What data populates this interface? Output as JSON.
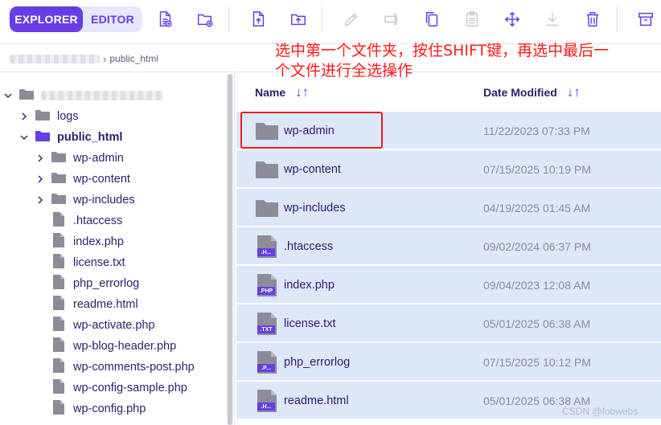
{
  "toolbar": {
    "tabs": [
      {
        "label": "EXPLORER",
        "active": true
      },
      {
        "label": "EDITOR",
        "active": false
      }
    ],
    "icons": [
      "new-file-icon",
      "new-folder-icon",
      "upload-file-icon",
      "upload-folder-icon",
      "rename-icon",
      "edit-icon",
      "copy-icon",
      "paste-icon",
      "move-icon",
      "download-icon",
      "delete-icon",
      "archive-icon"
    ],
    "accent": "#673de6"
  },
  "breadcrumb": {
    "current": "public_html"
  },
  "annotation": {
    "text": "选中第一个文件夹，按住SHIFT键，再选中最后一个文件进行全选操作",
    "color": "#ff1a1a"
  },
  "tree": {
    "items": [
      {
        "label": "logs",
        "type": "folder",
        "expandable": true,
        "expanded": false
      },
      {
        "label": "public_html",
        "type": "folder",
        "expandable": true,
        "expanded": true,
        "active": true
      },
      {
        "label": "wp-admin",
        "type": "folder",
        "expandable": true,
        "expanded": false
      },
      {
        "label": "wp-content",
        "type": "folder",
        "expandable": true,
        "expanded": false
      },
      {
        "label": "wp-includes",
        "type": "folder",
        "expandable": true,
        "expanded": false
      },
      {
        "label": ".htaccess",
        "type": "file"
      },
      {
        "label": "index.php",
        "type": "file"
      },
      {
        "label": "license.txt",
        "type": "file"
      },
      {
        "label": "php_errorlog",
        "type": "file"
      },
      {
        "label": "readme.html",
        "type": "file"
      },
      {
        "label": "wp-activate.php",
        "type": "file"
      },
      {
        "label": "wp-blog-header.php",
        "type": "file"
      },
      {
        "label": "wp-comments-post.php",
        "type": "file"
      },
      {
        "label": "wp-config-sample.php",
        "type": "file"
      },
      {
        "label": "wp-config.php",
        "type": "file"
      }
    ]
  },
  "table": {
    "columns": {
      "name": "Name",
      "date": "Date Modified"
    },
    "rows": [
      {
        "name": "wp-admin",
        "date": "11/22/2023 07:33 PM",
        "type": "folder",
        "badge": ""
      },
      {
        "name": "wp-content",
        "date": "07/15/2025 10:19 PM",
        "type": "folder",
        "badge": ""
      },
      {
        "name": "wp-includes",
        "date": "04/19/2025 01:45 AM",
        "type": "folder",
        "badge": ""
      },
      {
        "name": ".htaccess",
        "date": "09/02/2024 06:37 PM",
        "type": "file",
        "badge": ".H..."
      },
      {
        "name": "index.php",
        "date": "09/04/2023 12:08 AM",
        "type": "file",
        "badge": ".PHP"
      },
      {
        "name": "license.txt",
        "date": "05/01/2025 06:38 AM",
        "type": "file",
        "badge": ".TXT"
      },
      {
        "name": "php_errorlog",
        "date": "07/15/2025 10:12 PM",
        "type": "file",
        "badge": ".P..."
      },
      {
        "name": "readme.html",
        "date": "05/01/2025 06:38 AM",
        "type": "file",
        "badge": ".H..."
      }
    ],
    "selected_color": "#dce7f8"
  },
  "watermark": "CSDN @fobwebs"
}
